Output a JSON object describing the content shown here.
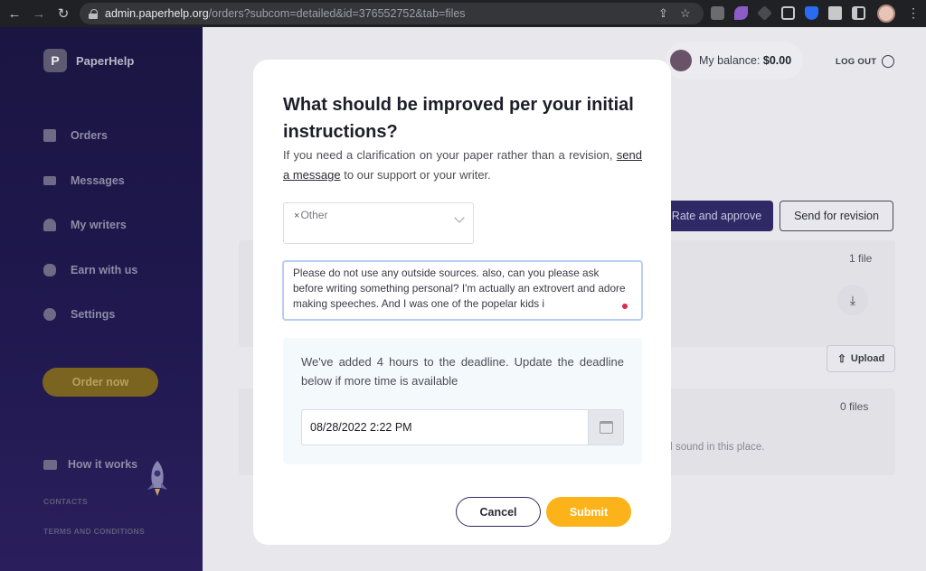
{
  "browser": {
    "url_host": "admin.paperhelp.org",
    "url_path": "/orders?subcom=detailed&id=376552752&tab=files",
    "icons": [
      "back-icon",
      "forward-icon",
      "reload-icon",
      "lock-icon",
      "share-icon",
      "star-icon",
      "extensions-icon",
      "profile-avatar",
      "menu-icon"
    ]
  },
  "sidebar": {
    "logo_letter": "P",
    "logo_text": "PaperHelp",
    "items": [
      {
        "label": "Orders",
        "icon": "document-icon"
      },
      {
        "label": "Messages",
        "icon": "envelope-icon"
      },
      {
        "label": "My writers",
        "icon": "users-icon"
      },
      {
        "label": "Earn with us",
        "icon": "coins-icon"
      },
      {
        "label": "Settings",
        "icon": "gear-icon"
      }
    ],
    "order_now": "Order now",
    "how_it_works": "How it works",
    "contacts": "CONTACTS",
    "terms": "TERMS AND CONDITIONS"
  },
  "header": {
    "balance_label": "My balance:",
    "balance_value": "$0.00",
    "logout": "LOG OUT"
  },
  "page": {
    "rate_button": "Rate and approve",
    "revision_button": "Send for revision",
    "files_count_1": "1 file",
    "upload": "Upload",
    "files_count_2": "0 files",
    "empty_text": "nd sound in this place."
  },
  "modal": {
    "title": "What should be improved per your initial instructions?",
    "desc_before": "If you need a clarification on your paper rather than a revision, ",
    "desc_link": "send a message",
    "desc_after": " to our support or your writer.",
    "select_tag": "Other",
    "textarea_value": "Please do not use any outside sources. also, can you please ask before writing something personal? I'm actually an extrovert and adore making speeches. And I was one of the popelar kids i",
    "info_text": "We've added 4 hours to the deadline. Update the deadline below if more time is available",
    "deadline_value": "08/28/2022 2:22 PM",
    "cancel": "Cancel",
    "submit": "Submit"
  },
  "colors": {
    "accent": "#fbb319",
    "brand_dark": "#2f2a66",
    "sidebar_bg": "#1b1542"
  }
}
